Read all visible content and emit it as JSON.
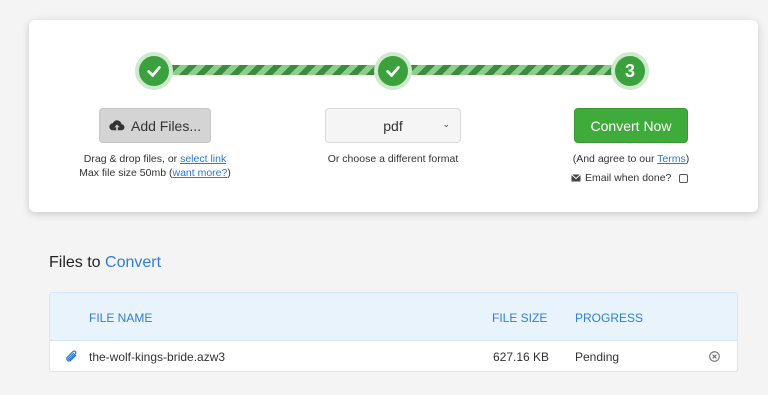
{
  "steps": [
    {
      "label": "",
      "state": "done"
    },
    {
      "label": "",
      "state": "done"
    },
    {
      "label": "3",
      "state": "current"
    }
  ],
  "upload": {
    "button_label": "Add Files...",
    "drag_text": "Drag & drop files, or ",
    "select_link": "select link",
    "max_text": "Max file size 50mb (",
    "want_more_link": "want more?",
    "max_text_end": ")"
  },
  "format": {
    "selected": "pdf",
    "help": "Or choose a different format"
  },
  "convert": {
    "button_label": "Convert Now",
    "agree_text": "(And agree to our ",
    "terms_link": "Terms",
    "agree_end": ")",
    "email_label": "Email when done?"
  },
  "files_section": {
    "title_prefix": "Files to",
    "title_accent": "Convert",
    "columns": {
      "name": "FILE NAME",
      "size": "FILE SIZE",
      "progress": "PROGRESS"
    },
    "rows": [
      {
        "name": "the-wolf-kings-bride.azw3",
        "size": "627.16 KB",
        "progress": "Pending"
      }
    ]
  },
  "colors": {
    "accent_green": "#3eab3a",
    "link_blue": "#2f7fd6"
  }
}
